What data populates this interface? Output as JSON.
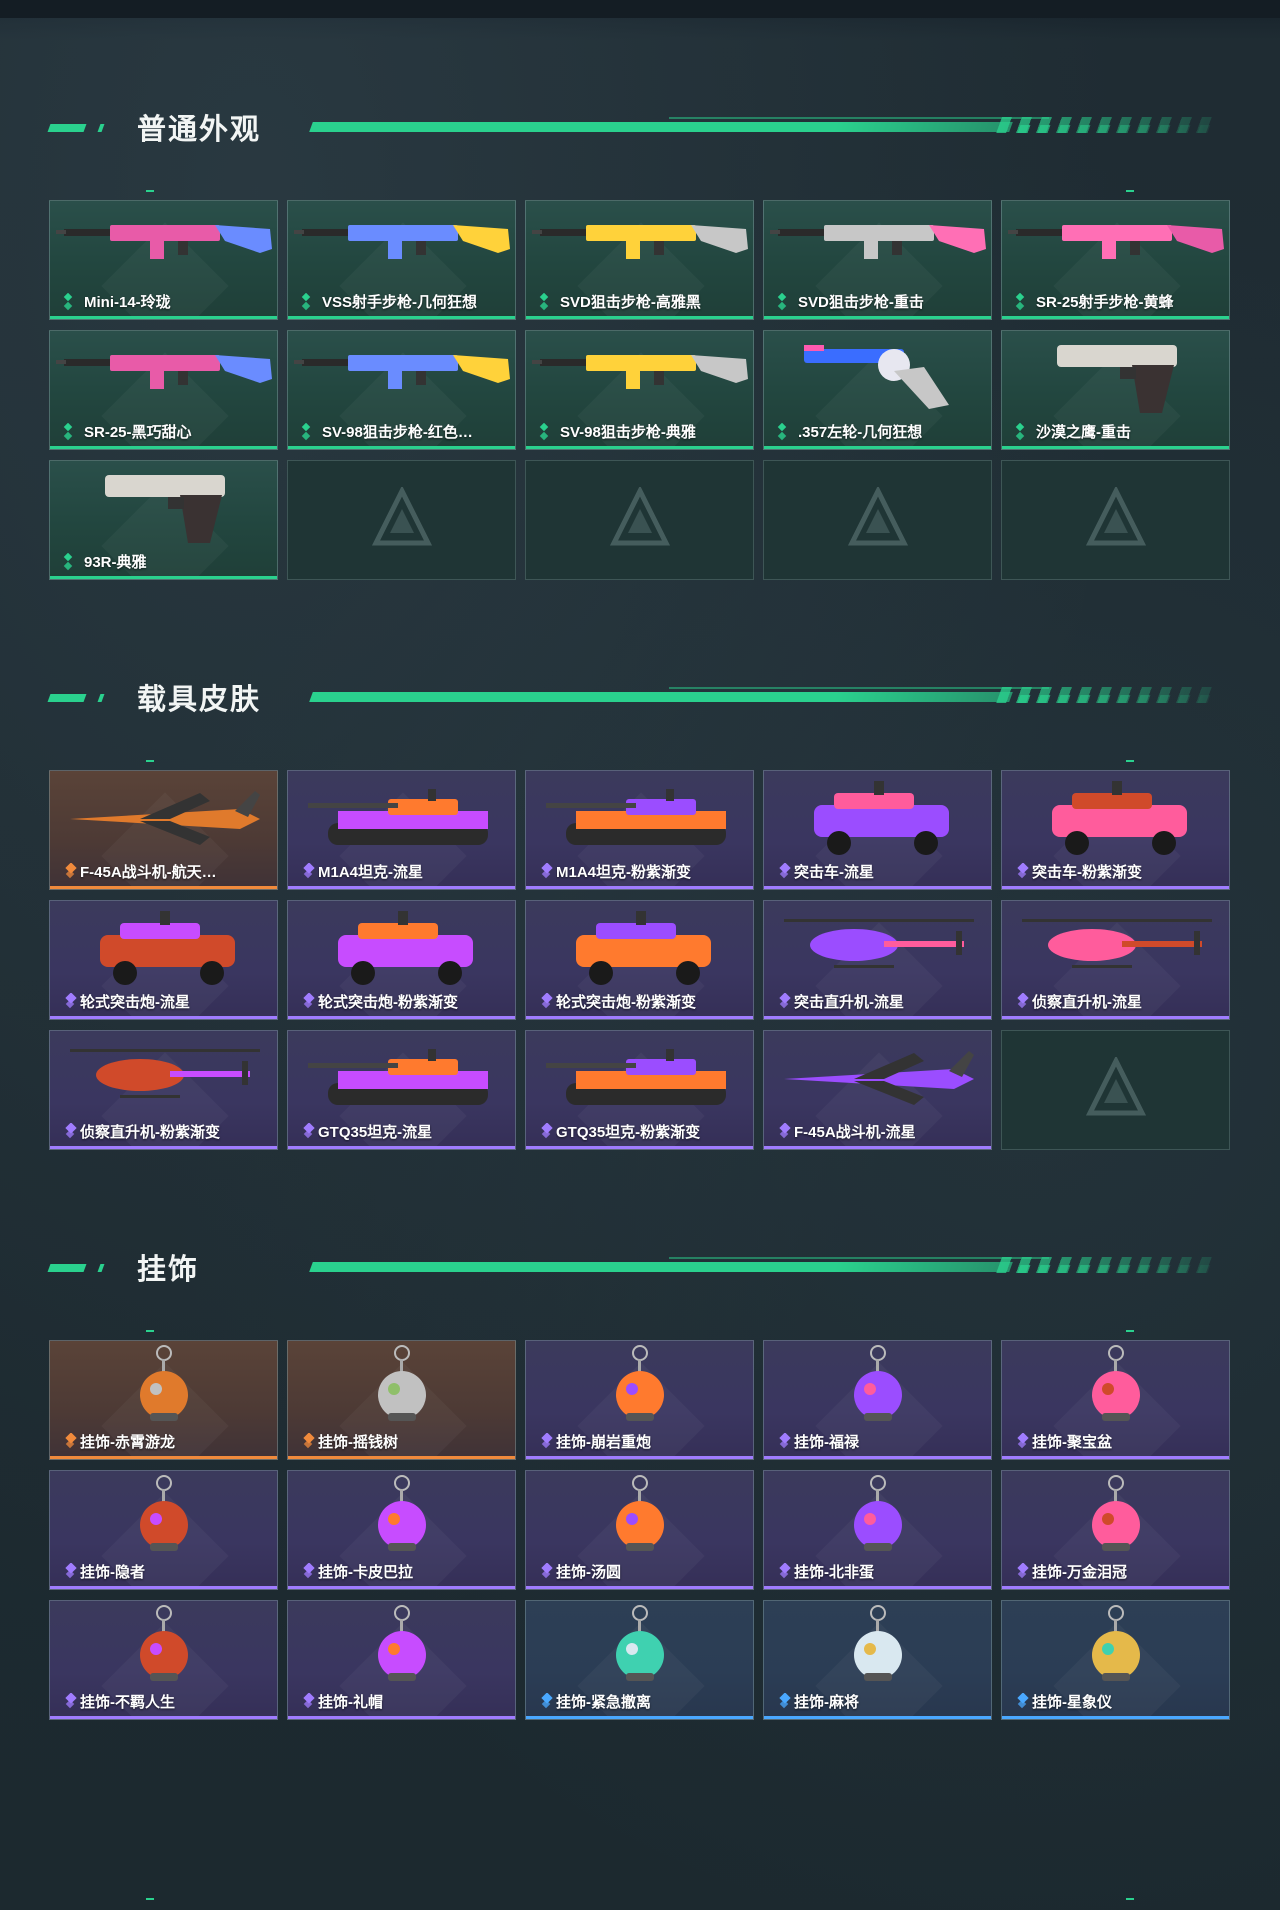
{
  "colors": {
    "accent": "#2ad18e",
    "rarity_green": "#2ad18e",
    "rarity_purple": "#a07cff",
    "rarity_orange": "#f08a3c",
    "rarity_blue": "#4aa8ff"
  },
  "sections": [
    {
      "title": "普通外观",
      "items": [
        {
          "label": "Mini-14-玲珑",
          "rarity": "green",
          "art": "rifle-icon"
        },
        {
          "label": "VSS射手步枪-几何狂想",
          "rarity": "green",
          "art": "rifle-icon"
        },
        {
          "label": "SVD狙击步枪-高雅黑",
          "rarity": "green",
          "art": "rifle-icon"
        },
        {
          "label": "SVD狙击步枪-重击",
          "rarity": "green",
          "art": "rifle-icon"
        },
        {
          "label": "SR-25射手步枪-黄蜂",
          "rarity": "green",
          "art": "rifle-icon"
        },
        {
          "label": "SR-25-黑巧甜心",
          "rarity": "green",
          "art": "rifle-icon"
        },
        {
          "label": "SV-98狙击步枪-红色…",
          "rarity": "green",
          "art": "rifle-icon"
        },
        {
          "label": "SV-98狙击步枪-典雅",
          "rarity": "green",
          "art": "rifle-icon"
        },
        {
          "label": ".357左轮-几何狂想",
          "rarity": "green",
          "art": "revolver-icon"
        },
        {
          "label": "沙漠之鹰-重击",
          "rarity": "green",
          "art": "pistol-icon"
        },
        {
          "label": "93R-典雅",
          "rarity": "green",
          "art": "pistol-icon"
        },
        {
          "label": "",
          "rarity": "empty"
        },
        {
          "label": "",
          "rarity": "empty"
        },
        {
          "label": "",
          "rarity": "empty"
        },
        {
          "label": "",
          "rarity": "empty"
        }
      ]
    },
    {
      "title": "载具皮肤",
      "items": [
        {
          "label": "F-45A战斗机-航天…",
          "rarity": "orange",
          "art": "jet-icon"
        },
        {
          "label": "M1A4坦克-流星",
          "rarity": "purple",
          "art": "tank-icon"
        },
        {
          "label": "M1A4坦克-粉紫渐变",
          "rarity": "purple",
          "art": "tank-icon"
        },
        {
          "label": "突击车-流星",
          "rarity": "purple",
          "art": "truck-icon"
        },
        {
          "label": "突击车-粉紫渐变",
          "rarity": "purple",
          "art": "truck-icon"
        },
        {
          "label": "轮式突击炮-流星",
          "rarity": "purple",
          "art": "armored-car-icon"
        },
        {
          "label": "轮式突击炮-粉紫渐变",
          "rarity": "purple",
          "art": "armored-car-icon"
        },
        {
          "label": "轮式突击炮-粉紫渐变",
          "rarity": "purple",
          "art": "armored-car-icon"
        },
        {
          "label": "突击直升机-流星",
          "rarity": "purple",
          "art": "helicopter-icon"
        },
        {
          "label": "侦察直升机-流星",
          "rarity": "purple",
          "art": "helicopter-icon"
        },
        {
          "label": "侦察直升机-粉紫渐变",
          "rarity": "purple",
          "art": "helicopter-icon"
        },
        {
          "label": "GTQ35坦克-流星",
          "rarity": "purple",
          "art": "tank-icon"
        },
        {
          "label": "GTQ35坦克-粉紫渐变",
          "rarity": "purple",
          "art": "tank-icon"
        },
        {
          "label": "F-45A战斗机-流星",
          "rarity": "purple",
          "art": "jet-icon"
        },
        {
          "label": "",
          "rarity": "empty"
        }
      ]
    },
    {
      "title": "挂饰",
      "items": [
        {
          "label": "挂饰-赤霄游龙",
          "rarity": "orange",
          "art": "charm-icon"
        },
        {
          "label": "挂饰-摇钱树",
          "rarity": "orange",
          "art": "charm-icon"
        },
        {
          "label": "挂饰-崩岩重炮",
          "rarity": "purple",
          "art": "charm-icon"
        },
        {
          "label": "挂饰-福禄",
          "rarity": "purple",
          "art": "charm-icon"
        },
        {
          "label": "挂饰-聚宝盆",
          "rarity": "purple",
          "art": "charm-icon"
        },
        {
          "label": "挂饰-隐者",
          "rarity": "purple",
          "art": "charm-icon"
        },
        {
          "label": "挂饰-卡皮巴拉",
          "rarity": "purple",
          "art": "charm-icon"
        },
        {
          "label": "挂饰-汤圆",
          "rarity": "purple",
          "art": "charm-icon"
        },
        {
          "label": "挂饰-北非蛋",
          "rarity": "purple",
          "art": "charm-icon"
        },
        {
          "label": "挂饰-万金泪冠",
          "rarity": "purple",
          "art": "charm-icon"
        },
        {
          "label": "挂饰-不羁人生",
          "rarity": "purple",
          "art": "charm-icon"
        },
        {
          "label": "挂饰-礼帽",
          "rarity": "purple",
          "art": "charm-icon"
        },
        {
          "label": "挂饰-紧急撤离",
          "rarity": "blue",
          "art": "charm-icon"
        },
        {
          "label": "挂饰-麻将",
          "rarity": "blue",
          "art": "charm-icon"
        },
        {
          "label": "挂饰-星象仪",
          "rarity": "blue",
          "art": "charm-icon"
        }
      ]
    }
  ]
}
